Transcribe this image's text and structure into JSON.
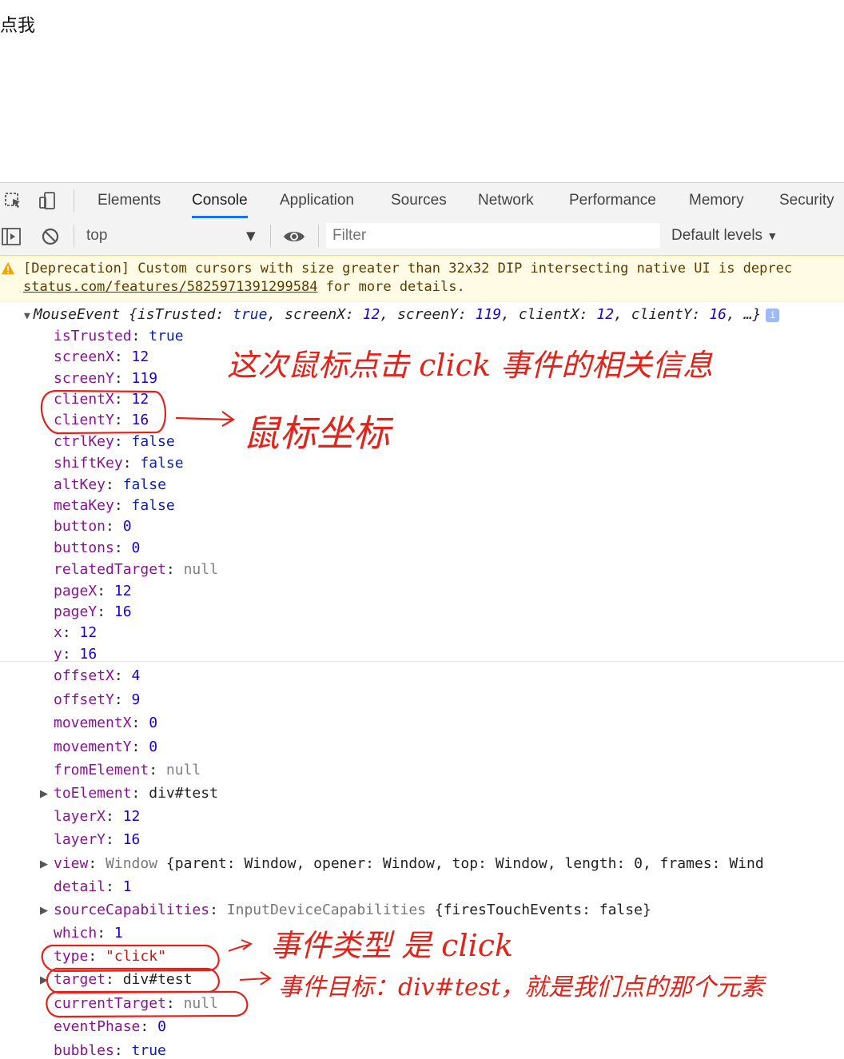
{
  "page": {
    "button_text": "点我"
  },
  "devtools": {
    "tabs": [
      {
        "label": "Elements"
      },
      {
        "label": "Console",
        "active": true
      },
      {
        "label": "Application"
      },
      {
        "label": "Sources"
      },
      {
        "label": "Network"
      },
      {
        "label": "Performance"
      },
      {
        "label": "Memory"
      },
      {
        "label": "Security"
      }
    ],
    "toolbar": {
      "context": "top",
      "filter_placeholder": "Filter",
      "levels": "Default levels"
    },
    "warning": {
      "line1": "[Deprecation] Custom cursors with size greater than 32x32 DIP intersecting native UI is deprec",
      "link": "status.com/features/5825971391299584",
      "line2_rest": " for more details."
    },
    "event": {
      "summary_name": "MouseEvent",
      "summary_props": [
        {
          "k": "isTrusted",
          "v": "true",
          "t": "bool"
        },
        {
          "k": "screenX",
          "v": "12",
          "t": "num"
        },
        {
          "k": "screenY",
          "v": "119",
          "t": "num"
        },
        {
          "k": "clientX",
          "v": "12",
          "t": "num"
        },
        {
          "k": "clientY",
          "v": "16",
          "t": "num"
        }
      ],
      "summary_tail": "…}",
      "properties": [
        {
          "key": "isTrusted",
          "value": "true",
          "type": "bool"
        },
        {
          "key": "screenX",
          "value": "12",
          "type": "num"
        },
        {
          "key": "screenY",
          "value": "119",
          "type": "num"
        },
        {
          "key": "clientX",
          "value": "12",
          "type": "num"
        },
        {
          "key": "clientY",
          "value": "16",
          "type": "num"
        },
        {
          "key": "ctrlKey",
          "value": "false",
          "type": "bool"
        },
        {
          "key": "shiftKey",
          "value": "false",
          "type": "bool"
        },
        {
          "key": "altKey",
          "value": "false",
          "type": "bool"
        },
        {
          "key": "metaKey",
          "value": "false",
          "type": "bool"
        },
        {
          "key": "button",
          "value": "0",
          "type": "num"
        },
        {
          "key": "buttons",
          "value": "0",
          "type": "num"
        },
        {
          "key": "relatedTarget",
          "value": "null",
          "type": "nul"
        },
        {
          "key": "pageX",
          "value": "12",
          "type": "num"
        },
        {
          "key": "pageY",
          "value": "16",
          "type": "num"
        },
        {
          "key": "x",
          "value": "12",
          "type": "num"
        },
        {
          "key": "y",
          "value": "16",
          "type": "num"
        },
        {
          "key": "offsetX",
          "value": "4",
          "type": "num"
        },
        {
          "key": "offsetY",
          "value": "9",
          "type": "num"
        },
        {
          "key": "movementX",
          "value": "0",
          "type": "num"
        },
        {
          "key": "movementY",
          "value": "0",
          "type": "num"
        },
        {
          "key": "fromElement",
          "value": "null",
          "type": "nul"
        },
        {
          "key": "toElement",
          "value": "div#test",
          "type": "obj",
          "expandable": true
        },
        {
          "key": "layerX",
          "value": "12",
          "type": "num"
        },
        {
          "key": "layerY",
          "value": "16",
          "type": "num"
        },
        {
          "key": "view",
          "value": "Window {parent: Window, opener: Window, top: Window, length: 0, frames: Wind",
          "type": "obj",
          "expandable": true
        },
        {
          "key": "detail",
          "value": "1",
          "type": "num"
        },
        {
          "key": "sourceCapabilities",
          "value": "InputDeviceCapabilities {firesTouchEvents: false}",
          "type": "obj",
          "expandable": true
        },
        {
          "key": "which",
          "value": "1",
          "type": "num"
        },
        {
          "key": "type",
          "value": "\"click\"",
          "type": "str"
        },
        {
          "key": "target",
          "value": "div#test",
          "type": "obj",
          "expandable": true
        },
        {
          "key": "currentTarget",
          "value": "null",
          "type": "nul"
        },
        {
          "key": "eventPhase",
          "value": "0",
          "type": "num"
        },
        {
          "key": "bubbles",
          "value": "true",
          "type": "bool"
        }
      ]
    }
  },
  "annotations": {
    "event_info": "这次鼠标点击 click 事件的相关信息",
    "mouse_coords": "鼠标坐标",
    "event_type": "事件类型 是 click",
    "event_target": "事件目标：div#test，就是我们点的那个元素",
    "color": "#e0241b"
  }
}
